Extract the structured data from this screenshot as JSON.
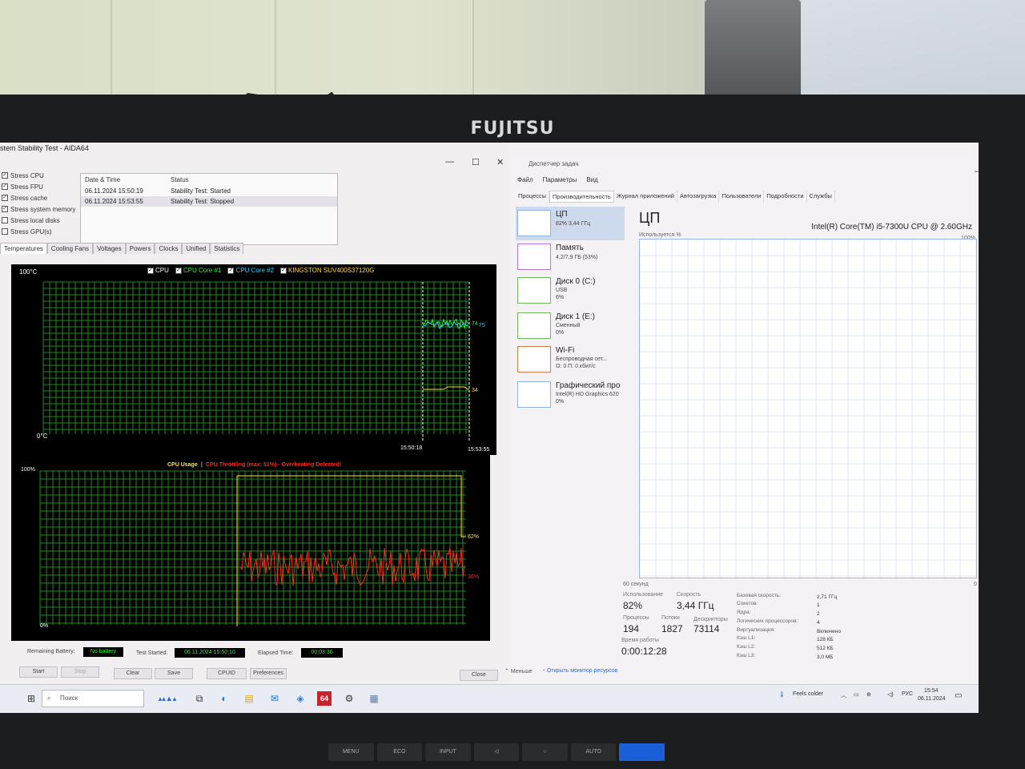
{
  "monitor": {
    "brand": "FUJITSU",
    "buttons": [
      "MENU",
      "ECO",
      "INPUT",
      "◁",
      "○",
      "AUTO",
      ""
    ]
  },
  "aida": {
    "title": "stem Stability Test - AIDA64",
    "options": [
      {
        "label": "Stress CPU",
        "checked": true
      },
      {
        "label": "Stress FPU",
        "checked": true
      },
      {
        "label": "Stress cache",
        "checked": true
      },
      {
        "label": "Stress system memory",
        "checked": true
      },
      {
        "label": "Stress local disks",
        "checked": false
      },
      {
        "label": "Stress GPU(s)",
        "checked": false
      }
    ],
    "status_table": {
      "headers": [
        "Date & Time",
        "Status"
      ],
      "rows": [
        [
          "06.11.2024 15:50:19",
          "Stability Test: Started"
        ],
        [
          "06.11.2024 15:53:55",
          "Stability Test: Stopped"
        ]
      ]
    },
    "tabs": [
      "Temperatures",
      "Cooling Fans",
      "Voltages",
      "Powers",
      "Clocks",
      "Unified",
      "Statistics"
    ],
    "temp_graph": {
      "legend": [
        {
          "label": "CPU",
          "color": "#ffffff"
        },
        {
          "label": "CPU Core #1",
          "color": "#2cf52c"
        },
        {
          "label": "CPU Core #2",
          "color": "#30d0ff"
        },
        {
          "label": "KINGSTON SUV400S37120G",
          "color": "#ffd84a"
        }
      ],
      "y_top": "100°C",
      "y_bottom": "0°C",
      "x_start": "15:50:18",
      "x_end": "15:53:55",
      "val_cpu": "74",
      "val_core": "75",
      "val_disk": "34"
    },
    "usage_graph": {
      "title_a": "CPU Usage",
      "sep": "|",
      "title_b": "CPU Throttling (max: 51%) - Overheating Detected!",
      "y_top": "100%",
      "y_bottom": "0%",
      "val_usage": "62%",
      "val_throttle": "36%"
    },
    "bottom": {
      "battery_label": "Remaining Battery:",
      "battery_value": "No battery",
      "started_label": "Test Started:",
      "started_value": "06.11.2024 15:50:10",
      "elapsed_label": "Elapsed Time:",
      "elapsed_value": "00:03:36",
      "buttons": [
        "Start",
        "Stop",
        "Clear",
        "Save",
        "CPUID",
        "Preferences",
        "Close"
      ]
    }
  },
  "taskmgr": {
    "title": "Диспетчер задач",
    "menu": [
      "Файл",
      "Параметры",
      "Вид"
    ],
    "tabs": [
      "Процессы",
      "Производительность",
      "Журнал приложений",
      "Автозагрузка",
      "Пользователи",
      "Подробности",
      "Службы"
    ],
    "side": [
      {
        "name": "ЦП",
        "sub1": "82% 3,44 ГГц",
        "sub2": ""
      },
      {
        "name": "Память",
        "sub1": "4,2/7,9 ГБ (53%)",
        "sub2": ""
      },
      {
        "name": "Диск 0 (C:)",
        "sub1": "USB",
        "sub2": "6%"
      },
      {
        "name": "Диск 1 (E:)",
        "sub1": "Сменный",
        "sub2": "0%"
      },
      {
        "name": "Wi-Fi",
        "sub1": "Беспроводная сет...",
        "sub2": "О: 0 П: 0 кбит/с"
      },
      {
        "name": "Графический про",
        "sub1": "Intel(R) HD Graphics 620",
        "sub2": "0%"
      }
    ],
    "cpu": {
      "heading": "ЦП",
      "model": "Intel(R) Core(TM) i5-7300U CPU @ 2.60GHz",
      "graph_label": "Используется %",
      "graph_max": "100%",
      "graph_time": "60 секунд",
      "graph_min": "0",
      "usage_label": "Использование",
      "usage": "82%",
      "speed_label": "Скорость",
      "speed": "3,44 ГГц",
      "proc_label": "Процессы",
      "proc": "194",
      "threads_label": "Потоки",
      "threads": "1827",
      "handles_label": "Дескрипторы",
      "handles": "73114",
      "uptime_label": "Время работы",
      "uptime": "0:00:12:28",
      "details": [
        {
          "k": "Базовая скорость:",
          "v": "2,71 ГГц"
        },
        {
          "k": "Сокетов:",
          "v": "1"
        },
        {
          "k": "Ядра:",
          "v": "2"
        },
        {
          "k": "Логических процессоров:",
          "v": "4"
        },
        {
          "k": "Виртуализация:",
          "v": "Включено"
        },
        {
          "k": "Кэш L1:",
          "v": "128 КБ"
        },
        {
          "k": "Кэш L2:",
          "v": "512 КБ"
        },
        {
          "k": "Кэш L3:",
          "v": "3,0 МБ"
        }
      ]
    },
    "footer": {
      "less": "Меньше",
      "monitor": "Открыть монитор ресурсов"
    }
  },
  "taskbar": {
    "search": "Поиск",
    "weather": "Feels colder",
    "lang": "РУС",
    "time": "15:54",
    "date": "06.11.2024"
  }
}
